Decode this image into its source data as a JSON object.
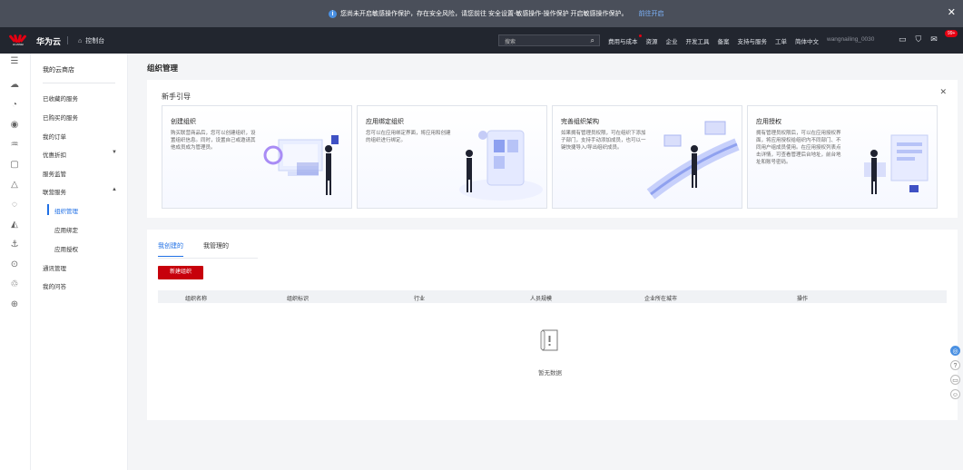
{
  "notice": {
    "message": "您尚未开启敏感操作保护，存在安全风险，请您前往 安全设置-敏感操作-操作保护 开启敏感操作保护。",
    "link": "前往开启",
    "info_icon": "info-icon",
    "close_icon": "close-icon"
  },
  "topnav": {
    "logo_text": "HUAWEI",
    "brand": "华为云",
    "console": "控制台",
    "search_placeholder": "搜索",
    "links": [
      "费用与成本",
      "资源",
      "企业",
      "开发工具",
      "备案",
      "支持与服务",
      "工单",
      "简体中文"
    ],
    "user": "wangnailing_0030",
    "badge": "99+"
  },
  "sidebar": {
    "title": "我的云商店",
    "items": [
      {
        "label": "已收藏的服务"
      },
      {
        "label": "已购买的服务"
      },
      {
        "label": "我的订单"
      },
      {
        "label": "优惠折扣"
      },
      {
        "label": "服务监管"
      },
      {
        "label": "联营服务"
      },
      {
        "label": "组织管理"
      },
      {
        "label": "应用绑定"
      },
      {
        "label": "应用授权"
      },
      {
        "label": "通讯管理"
      },
      {
        "label": "我的问答"
      }
    ]
  },
  "main": {
    "title": "组织管理"
  },
  "guide": {
    "title": "新手引导",
    "cards": [
      {
        "title": "创建组织",
        "desc": "购买联营商品后，您可以创建组织，设置组织信息。同时，设置自己或邀请其他成员成为管理员。"
      },
      {
        "title": "应用绑定组织",
        "desc": "您可以在应用绑定界面，将应用和创建的组织进行绑定。"
      },
      {
        "title": "完善组织架构",
        "desc": "如果拥有管理员权限，可在组织下添加子部门，支持手动添加成员，也可以一键快捷导入/导出组织成员。"
      },
      {
        "title": "应用授权",
        "desc": "拥有管理员权限后，可以在应用授权界面，将应用授权给组织内不同部门、不同用户组成员使用。在应用授权列表点击详情，可查看管理后台地址，前台地址和账号密码。"
      }
    ]
  },
  "panel": {
    "tabs": [
      "我创建的",
      "我管理的"
    ],
    "new_button": "新建组织",
    "columns": [
      "组织名称",
      "组织标识",
      "行业",
      "人员规模",
      "企业所在城市",
      "操作"
    ],
    "empty_text": "暂无数据"
  },
  "colors": {
    "accent": "#1f6fe5",
    "brand_red": "#c7000b",
    "topbar": "#22262f"
  }
}
